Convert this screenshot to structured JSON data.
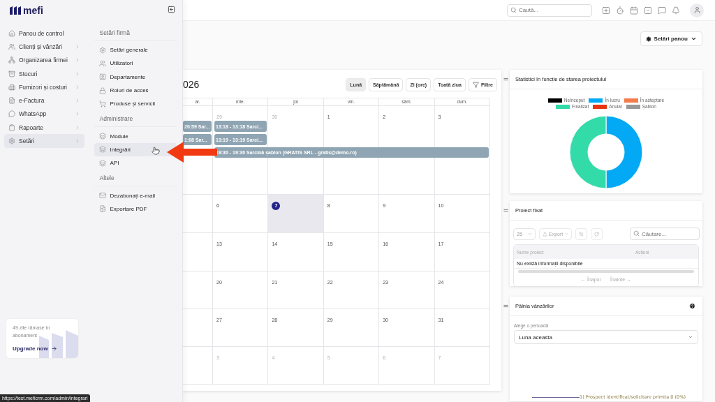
{
  "sidebar": {
    "logo": "mefi",
    "items": [
      {
        "label": "Panou de control",
        "has_submenu": false,
        "selected": false
      },
      {
        "label": "Clienți și vânzări",
        "has_submenu": true,
        "selected": false
      },
      {
        "label": "Organizarea firmei",
        "has_submenu": true,
        "selected": false
      },
      {
        "label": "Stocuri",
        "has_submenu": true,
        "selected": false
      },
      {
        "label": "Furnizori și costuri",
        "has_submenu": true,
        "selected": false
      },
      {
        "label": "e-Factura",
        "has_submenu": true,
        "selected": false
      },
      {
        "label": "WhatsApp",
        "has_submenu": true,
        "selected": false
      },
      {
        "label": "Rapoarte",
        "has_submenu": true,
        "selected": false
      },
      {
        "label": "Setări",
        "has_submenu": true,
        "selected": true
      }
    ],
    "upgrade": {
      "text": "49 zile rămase în abonament",
      "link": "Upgrade now"
    }
  },
  "submenu": {
    "sections": [
      {
        "title": "Setări firmă",
        "items": [
          {
            "label": "Setări generale",
            "hovered": false
          },
          {
            "label": "Utilizatori",
            "hovered": false
          },
          {
            "label": "Departamente",
            "hovered": false
          },
          {
            "label": "Roluri de acces",
            "hovered": false
          },
          {
            "label": "Produse și servicii",
            "hovered": false
          }
        ]
      },
      {
        "title": "Administrare",
        "items": [
          {
            "label": "Module",
            "hovered": false
          },
          {
            "label": "Integrări",
            "hovered": true
          },
          {
            "label": "API",
            "hovered": false
          }
        ]
      },
      {
        "title": "Altele",
        "items": [
          {
            "label": "Dezabonați e-mail",
            "hovered": false
          },
          {
            "label": "Exportare PDF",
            "hovered": false
          }
        ]
      }
    ]
  },
  "status_url": "https://test.meficrm.com/admin/integrari",
  "topbar": {
    "search": {
      "placeholder": "Caută..."
    }
  },
  "panel_settings_button": "Setări panou",
  "calendar": {
    "title": "026",
    "view_buttons": [
      {
        "label": "Lună",
        "selected": true
      },
      {
        "label": "Săptămână",
        "selected": false
      },
      {
        "label": "Zi (ore)",
        "selected": false
      },
      {
        "label": "Toată ziua",
        "selected": false
      }
    ],
    "filter_button": "Filtre",
    "weekdays": [
      "ar.",
      "mie.",
      "joi",
      "vin.",
      "sâm.",
      "dum."
    ],
    "weeks": [
      {
        "cut_day_events": [
          "20:59 Sar...",
          "1:08 Sar..."
        ],
        "days": [
          {
            "label": "29",
            "muted": true,
            "today": false,
            "events": [
              {
                "label": "13:18 - 13:18 Sarci...",
                "to_week_end": false
              },
              {
                "label": "13:19 - 13:19 Sarci...",
                "to_week_end": false
              },
              {
                "label": "19:30 - 19:30 Sarcină șablon (GRATIS SRL - gratis@demo.ro)",
                "to_week_end": true
              }
            ]
          },
          {
            "label": "30",
            "muted": true,
            "today": false
          },
          {
            "label": "1",
            "muted": false,
            "today": false
          },
          {
            "label": "2",
            "muted": false,
            "today": false
          },
          {
            "label": "3",
            "muted": false,
            "today": false
          }
        ]
      },
      {
        "days": [
          {
            "label": "6",
            "muted": false,
            "today": false
          },
          {
            "label": "7",
            "muted": false,
            "today": true
          },
          {
            "label": "8",
            "muted": false,
            "today": false
          },
          {
            "label": "9",
            "muted": false,
            "today": false
          },
          {
            "label": "10",
            "muted": false,
            "today": false
          }
        ]
      },
      {
        "days": [
          {
            "label": "13",
            "muted": false,
            "today": false
          },
          {
            "label": "14",
            "muted": false,
            "today": false
          },
          {
            "label": "15",
            "muted": false,
            "today": false
          },
          {
            "label": "16",
            "muted": false,
            "today": false
          },
          {
            "label": "17",
            "muted": false,
            "today": false
          }
        ]
      },
      {
        "days": [
          {
            "label": "20",
            "muted": false,
            "today": false
          },
          {
            "label": "21",
            "muted": false,
            "today": false
          },
          {
            "label": "22",
            "muted": false,
            "today": false
          },
          {
            "label": "23",
            "muted": false,
            "today": false
          },
          {
            "label": "24",
            "muted": false,
            "today": false
          }
        ]
      },
      {
        "days": [
          {
            "label": "27",
            "muted": false,
            "today": false
          },
          {
            "label": "28",
            "muted": false,
            "today": false
          },
          {
            "label": "29",
            "muted": false,
            "today": false
          },
          {
            "label": "30",
            "muted": false,
            "today": false
          },
          {
            "label": "31",
            "muted": false,
            "today": false
          }
        ]
      },
      {
        "days": [
          {
            "label": "3",
            "muted": true,
            "today": false
          },
          {
            "label": "4",
            "muted": true,
            "today": false
          },
          {
            "label": "5",
            "muted": true,
            "today": false
          },
          {
            "label": "6",
            "muted": true,
            "today": false
          },
          {
            "label": "7",
            "muted": true,
            "today": false
          }
        ]
      }
    ]
  },
  "status_chart": {
    "title": "Statistici în funcție de starea proiectului",
    "legend": [
      {
        "label": "Neînceput",
        "color": "#000000"
      },
      {
        "label": "În lucru",
        "color": "#03a9f4"
      },
      {
        "label": "În așteptare",
        "color": "#f47c4a"
      },
      {
        "label": "Finalizat",
        "color": "#33dba9"
      },
      {
        "label": "Anulat",
        "color": "#e8350f"
      },
      {
        "label": "Șablon",
        "color": "#999999"
      }
    ]
  },
  "pinned_projects": {
    "title": "Proiect fixat",
    "page_size": "25",
    "export_button": "Export",
    "search": {
      "placeholder": "Căutare..."
    },
    "columns": [
      "Nume proiect",
      "Acțiuni"
    ],
    "empty_message": "Nu există informații disponibile",
    "pagination": [
      {
        "label": "← Înapoi",
        "disabled": true
      },
      {
        "label": "Înainte →",
        "disabled": true
      }
    ]
  },
  "sales_funnel": {
    "title": "Pâlnia vânzărilor",
    "period_label": "Alege o perioadă",
    "period_value": "Luna aceasta",
    "stages": [
      "1) Prospect identificat/solicitare primita 0 (0%)"
    ]
  }
}
